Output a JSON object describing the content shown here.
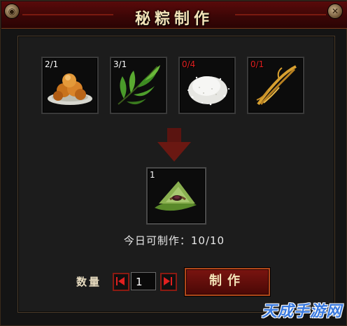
{
  "window": {
    "title": "秘粽制作",
    "left_ornament": "dragon-knot-icon",
    "close_icon": "close-icon"
  },
  "ingredients": [
    {
      "count": "2/1",
      "icon": "fried-dough-icon",
      "sufficient": true
    },
    {
      "count": "3/1",
      "icon": "bamboo-leaf-icon",
      "sufficient": true
    },
    {
      "count": "0/4",
      "icon": "rice-pile-icon",
      "sufficient": false
    },
    {
      "count": "0/1",
      "icon": "grass-rope-icon",
      "sufficient": false
    }
  ],
  "result": {
    "count": "1",
    "icon": "zongzi-icon"
  },
  "craftable_today": "今日可制作：10/10",
  "quantity": {
    "label": "数量",
    "value": "1"
  },
  "make_button": "制作",
  "watermark": "天成手游网",
  "colors": {
    "title_bar": "#5a0a0a",
    "accent_red": "#8a1a12",
    "short_red": "#e02020",
    "text_cream": "#f3e3b8"
  }
}
